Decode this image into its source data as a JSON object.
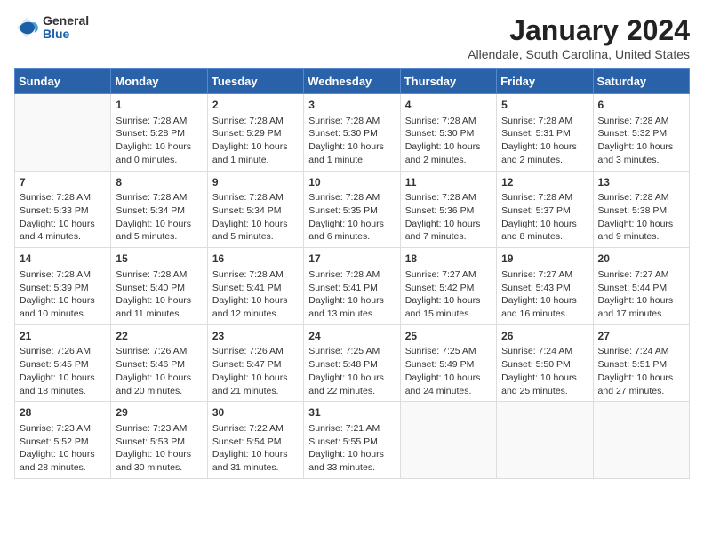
{
  "logo": {
    "general": "General",
    "blue": "Blue"
  },
  "title": "January 2024",
  "location": "Allendale, South Carolina, United States",
  "days_of_week": [
    "Sunday",
    "Monday",
    "Tuesday",
    "Wednesday",
    "Thursday",
    "Friday",
    "Saturday"
  ],
  "weeks": [
    [
      {
        "day": "",
        "info": ""
      },
      {
        "day": "1",
        "info": "Sunrise: 7:28 AM\nSunset: 5:28 PM\nDaylight: 10 hours\nand 0 minutes."
      },
      {
        "day": "2",
        "info": "Sunrise: 7:28 AM\nSunset: 5:29 PM\nDaylight: 10 hours\nand 1 minute."
      },
      {
        "day": "3",
        "info": "Sunrise: 7:28 AM\nSunset: 5:30 PM\nDaylight: 10 hours\nand 1 minute."
      },
      {
        "day": "4",
        "info": "Sunrise: 7:28 AM\nSunset: 5:30 PM\nDaylight: 10 hours\nand 2 minutes."
      },
      {
        "day": "5",
        "info": "Sunrise: 7:28 AM\nSunset: 5:31 PM\nDaylight: 10 hours\nand 2 minutes."
      },
      {
        "day": "6",
        "info": "Sunrise: 7:28 AM\nSunset: 5:32 PM\nDaylight: 10 hours\nand 3 minutes."
      }
    ],
    [
      {
        "day": "7",
        "info": "Sunrise: 7:28 AM\nSunset: 5:33 PM\nDaylight: 10 hours\nand 4 minutes."
      },
      {
        "day": "8",
        "info": "Sunrise: 7:28 AM\nSunset: 5:34 PM\nDaylight: 10 hours\nand 5 minutes."
      },
      {
        "day": "9",
        "info": "Sunrise: 7:28 AM\nSunset: 5:34 PM\nDaylight: 10 hours\nand 5 minutes."
      },
      {
        "day": "10",
        "info": "Sunrise: 7:28 AM\nSunset: 5:35 PM\nDaylight: 10 hours\nand 6 minutes."
      },
      {
        "day": "11",
        "info": "Sunrise: 7:28 AM\nSunset: 5:36 PM\nDaylight: 10 hours\nand 7 minutes."
      },
      {
        "day": "12",
        "info": "Sunrise: 7:28 AM\nSunset: 5:37 PM\nDaylight: 10 hours\nand 8 minutes."
      },
      {
        "day": "13",
        "info": "Sunrise: 7:28 AM\nSunset: 5:38 PM\nDaylight: 10 hours\nand 9 minutes."
      }
    ],
    [
      {
        "day": "14",
        "info": "Sunrise: 7:28 AM\nSunset: 5:39 PM\nDaylight: 10 hours\nand 10 minutes."
      },
      {
        "day": "15",
        "info": "Sunrise: 7:28 AM\nSunset: 5:40 PM\nDaylight: 10 hours\nand 11 minutes."
      },
      {
        "day": "16",
        "info": "Sunrise: 7:28 AM\nSunset: 5:41 PM\nDaylight: 10 hours\nand 12 minutes."
      },
      {
        "day": "17",
        "info": "Sunrise: 7:28 AM\nSunset: 5:41 PM\nDaylight: 10 hours\nand 13 minutes."
      },
      {
        "day": "18",
        "info": "Sunrise: 7:27 AM\nSunset: 5:42 PM\nDaylight: 10 hours\nand 15 minutes."
      },
      {
        "day": "19",
        "info": "Sunrise: 7:27 AM\nSunset: 5:43 PM\nDaylight: 10 hours\nand 16 minutes."
      },
      {
        "day": "20",
        "info": "Sunrise: 7:27 AM\nSunset: 5:44 PM\nDaylight: 10 hours\nand 17 minutes."
      }
    ],
    [
      {
        "day": "21",
        "info": "Sunrise: 7:26 AM\nSunset: 5:45 PM\nDaylight: 10 hours\nand 18 minutes."
      },
      {
        "day": "22",
        "info": "Sunrise: 7:26 AM\nSunset: 5:46 PM\nDaylight: 10 hours\nand 20 minutes."
      },
      {
        "day": "23",
        "info": "Sunrise: 7:26 AM\nSunset: 5:47 PM\nDaylight: 10 hours\nand 21 minutes."
      },
      {
        "day": "24",
        "info": "Sunrise: 7:25 AM\nSunset: 5:48 PM\nDaylight: 10 hours\nand 22 minutes."
      },
      {
        "day": "25",
        "info": "Sunrise: 7:25 AM\nSunset: 5:49 PM\nDaylight: 10 hours\nand 24 minutes."
      },
      {
        "day": "26",
        "info": "Sunrise: 7:24 AM\nSunset: 5:50 PM\nDaylight: 10 hours\nand 25 minutes."
      },
      {
        "day": "27",
        "info": "Sunrise: 7:24 AM\nSunset: 5:51 PM\nDaylight: 10 hours\nand 27 minutes."
      }
    ],
    [
      {
        "day": "28",
        "info": "Sunrise: 7:23 AM\nSunset: 5:52 PM\nDaylight: 10 hours\nand 28 minutes."
      },
      {
        "day": "29",
        "info": "Sunrise: 7:23 AM\nSunset: 5:53 PM\nDaylight: 10 hours\nand 30 minutes."
      },
      {
        "day": "30",
        "info": "Sunrise: 7:22 AM\nSunset: 5:54 PM\nDaylight: 10 hours\nand 31 minutes."
      },
      {
        "day": "31",
        "info": "Sunrise: 7:21 AM\nSunset: 5:55 PM\nDaylight: 10 hours\nand 33 minutes."
      },
      {
        "day": "",
        "info": ""
      },
      {
        "day": "",
        "info": ""
      },
      {
        "day": "",
        "info": ""
      }
    ]
  ]
}
